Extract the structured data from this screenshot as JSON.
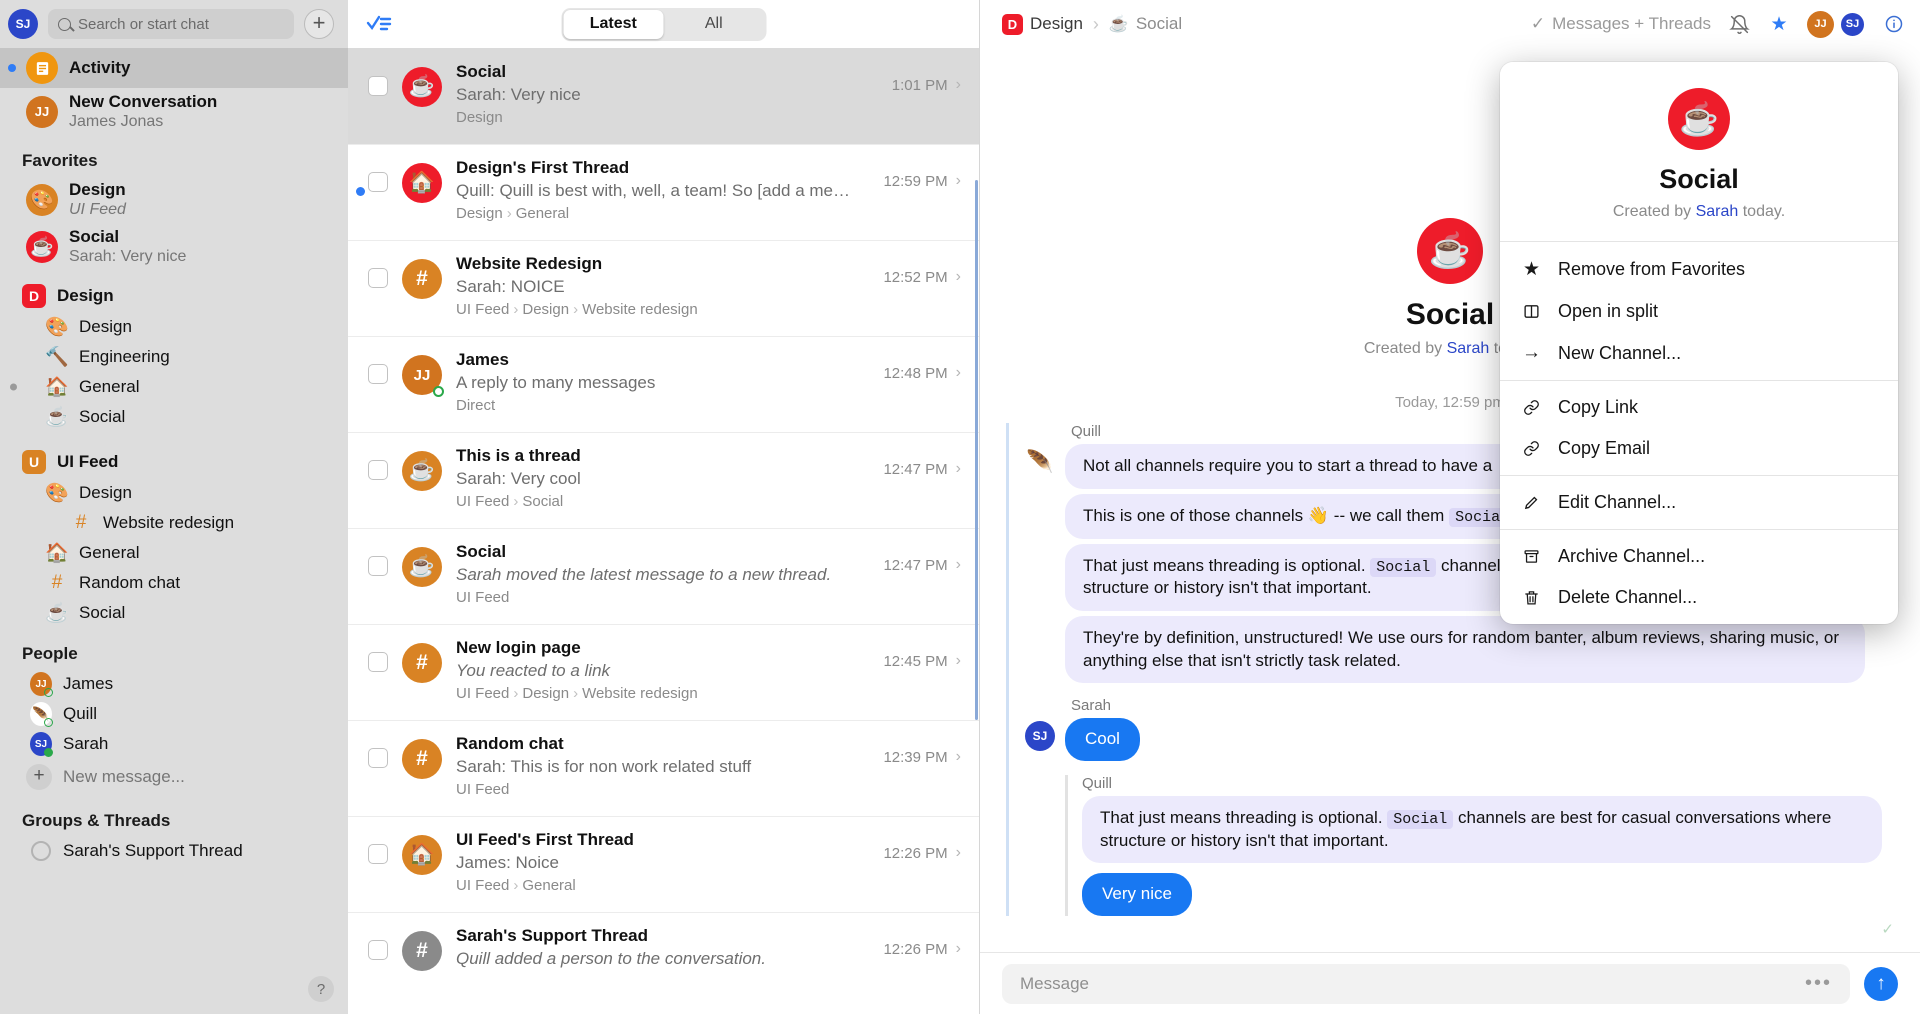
{
  "sidebar": {
    "user_initials": "SJ",
    "search_placeholder": "Search or start chat",
    "compose_icon": "plus-icon",
    "activity": {
      "label": "Activity",
      "icon": "activity-icon"
    },
    "new_conversation": {
      "label": "New Conversation",
      "sub": "James Jonas",
      "initials": "JJ"
    },
    "favorites_header": "Favorites",
    "favorites": [
      {
        "label": "Design",
        "sub": "UI Feed",
        "icon": "palette-icon",
        "color": "#d98324"
      },
      {
        "label": "Social",
        "sub": "Sarah: Very nice",
        "icon": "coffee-icon",
        "color": "#ee1c2a"
      }
    ],
    "team_design": {
      "label": "Design",
      "badge": "D",
      "color": "#ee1c2a",
      "channels": [
        {
          "label": "Design",
          "icon": "palette-icon"
        },
        {
          "label": "Engineering",
          "icon": "hammer-icon"
        },
        {
          "label": "General",
          "icon": "house-icon",
          "unread_dot": true
        },
        {
          "label": "Social",
          "icon": "coffee-icon"
        }
      ]
    },
    "team_uifeed": {
      "label": "UI Feed",
      "badge": "U",
      "color": "#d98324",
      "channels": [
        {
          "label": "Design",
          "icon": "palette-icon",
          "indent": 1
        },
        {
          "label": "Website redesign",
          "icon": "hash-icon",
          "indent": 2
        },
        {
          "label": "General",
          "icon": "house-icon",
          "indent": 1
        },
        {
          "label": "Random chat",
          "icon": "hash-icon",
          "indent": 1
        },
        {
          "label": "Social",
          "icon": "coffee-icon",
          "indent": 1
        }
      ]
    },
    "people_header": "People",
    "people": [
      {
        "label": "James",
        "initials": "JJ",
        "color": "#d1741f",
        "presence": "away"
      },
      {
        "label": "Quill",
        "initials": "Q",
        "color": "#ffffff",
        "presence": "away"
      },
      {
        "label": "Sarah",
        "initials": "SJ",
        "color": "#2b46c8",
        "presence": "online"
      }
    ],
    "new_message_label": "New message...",
    "groups_header": "Groups & Threads",
    "groups": [
      {
        "label": "Sarah's Support Thread"
      }
    ],
    "help_label": "?"
  },
  "list": {
    "select_icon": "checklist-icon",
    "tabs": [
      {
        "label": "Latest",
        "active": true
      },
      {
        "label": "All",
        "active": false
      }
    ],
    "items": [
      {
        "title": "Social",
        "preview": "Sarah: Very nice",
        "preview_italic": false,
        "path": [
          "Design"
        ],
        "time": "1:01 PM",
        "icon": "coffee-icon",
        "color": "#ee1c2a",
        "selected": true,
        "unread": false
      },
      {
        "title": "Design's First Thread",
        "preview": "Quill: Quill is best with, well, a team! So [add a me…",
        "preview_italic": false,
        "path": [
          "Design",
          "General"
        ],
        "time": "12:59 PM",
        "icon": "house-icon",
        "color": "#ee1c2a",
        "selected": false,
        "unread": true
      },
      {
        "title": "Website Redesign",
        "preview": "Sarah: NOICE",
        "preview_italic": false,
        "path": [
          "UI Feed",
          "Design",
          "Website redesign"
        ],
        "time": "12:52 PM",
        "icon": "hash-icon",
        "color": "#d98324",
        "selected": false,
        "unread": false
      },
      {
        "title": "James",
        "preview": "A reply to many messages",
        "preview_italic": false,
        "path": [
          "Direct"
        ],
        "time": "12:48 PM",
        "icon": "JJ",
        "color": "#d1741f",
        "selected": false,
        "unread": false,
        "presence": "away"
      },
      {
        "title": "This is a thread",
        "preview": "Sarah: Very cool",
        "preview_italic": false,
        "path": [
          "UI Feed",
          "Social"
        ],
        "time": "12:47 PM",
        "icon": "coffee-icon",
        "color": "#d98324",
        "selected": false,
        "unread": false
      },
      {
        "title": "Social",
        "preview": "Sarah moved the latest message to a new thread.",
        "preview_italic": true,
        "path": [
          "UI Feed"
        ],
        "time": "12:47 PM",
        "icon": "coffee-icon",
        "color": "#d98324",
        "selected": false,
        "unread": false
      },
      {
        "title": "New login page",
        "preview": "You reacted to a link",
        "preview_italic": true,
        "path": [
          "UI Feed",
          "Design",
          "Website redesign"
        ],
        "time": "12:45 PM",
        "icon": "hash-icon",
        "color": "#d98324",
        "selected": false,
        "unread": false
      },
      {
        "title": "Random chat",
        "preview": "Sarah: This is for non work related stuff",
        "preview_italic": false,
        "path": [
          "UI Feed"
        ],
        "time": "12:39 PM",
        "icon": "hash-icon",
        "color": "#d98324",
        "selected": false,
        "unread": false
      },
      {
        "title": "UI Feed's First Thread",
        "preview": "James: Noice",
        "preview_italic": false,
        "path": [
          "UI Feed",
          "General"
        ],
        "time": "12:26 PM",
        "icon": "house-icon",
        "color": "#d98324",
        "selected": false,
        "unread": false
      },
      {
        "title": "Sarah's Support Thread",
        "preview": "Quill added a person to the conversation.",
        "preview_italic": true,
        "path": [],
        "time": "12:26 PM",
        "icon": "hash-icon",
        "color": "#8a8a8a",
        "selected": false,
        "unread": false
      }
    ]
  },
  "topbar": {
    "breadcrumb_team": "Design",
    "breadcrumb_team_badge": "D",
    "breadcrumb_channel": "Social",
    "filter_label": "Messages + Threads",
    "filter_icon": "check-icon",
    "bell_icon": "bell-muted-icon",
    "star_icon": "star-icon",
    "avatars": [
      "JJ",
      "SJ"
    ],
    "overflow_icon": "info-icon"
  },
  "channel": {
    "name": "Social",
    "icon": "coffee-icon",
    "created_prefix": "Created by",
    "created_by": "Sarah",
    "created_suffix": "today.",
    "day_separator": "Today, 12:59 pm"
  },
  "messages": [
    {
      "author": "Quill",
      "avatar": "quill-icon",
      "bubbles": [
        {
          "text": "Not all channels require you to start a thread to have a",
          "truncated": true
        },
        {
          "text": "This is one of those channels 👋 -- we call them ",
          "code": "Social",
          "truncated": true
        },
        {
          "text": "That just means threading is optional. ",
          "code": "Social",
          "text2": " channels are best for casual conversations where structure or history isn't that important."
        },
        {
          "text": "They're by definition, unstructured! We use ours for random banter, album reviews, sharing music, or anything else that isn't strictly task related."
        }
      ]
    },
    {
      "author": "Sarah",
      "avatar": "SJ",
      "bubbles": [
        {
          "text": "Cool",
          "style": "blue"
        }
      ]
    },
    {
      "author": "Quill",
      "avatar": "quill-icon",
      "bubbles": [
        {
          "text": "That just means threading is optional. ",
          "code": "Social",
          "text2": " channels are best for casual conversations where structure or history isn't that important."
        }
      ]
    },
    {
      "author": "",
      "avatar": "",
      "bubbles": [
        {
          "text": "Very nice",
          "style": "blue"
        }
      ]
    }
  ],
  "composer": {
    "placeholder": "Message",
    "more_icon": "ellipsis-icon",
    "send_icon": "send-icon"
  },
  "context_menu": {
    "avatar_icon": "coffee-icon",
    "title": "Social",
    "created_prefix": "Created by",
    "created_by": "Sarah",
    "created_suffix": "today.",
    "groups": [
      [
        {
          "label": "Remove from Favorites",
          "icon": "star-icon"
        },
        {
          "label": "Open in split",
          "icon": "split-icon"
        },
        {
          "label": "New Channel...",
          "icon": "arrow-right-icon"
        }
      ],
      [
        {
          "label": "Copy Link",
          "icon": "link-icon"
        },
        {
          "label": "Copy Email",
          "icon": "link-icon"
        }
      ],
      [
        {
          "label": "Edit Channel...",
          "icon": "pencil-icon"
        }
      ],
      [
        {
          "label": "Archive Channel...",
          "icon": "archive-icon"
        },
        {
          "label": "Delete Channel...",
          "icon": "trash-icon"
        }
      ]
    ]
  }
}
